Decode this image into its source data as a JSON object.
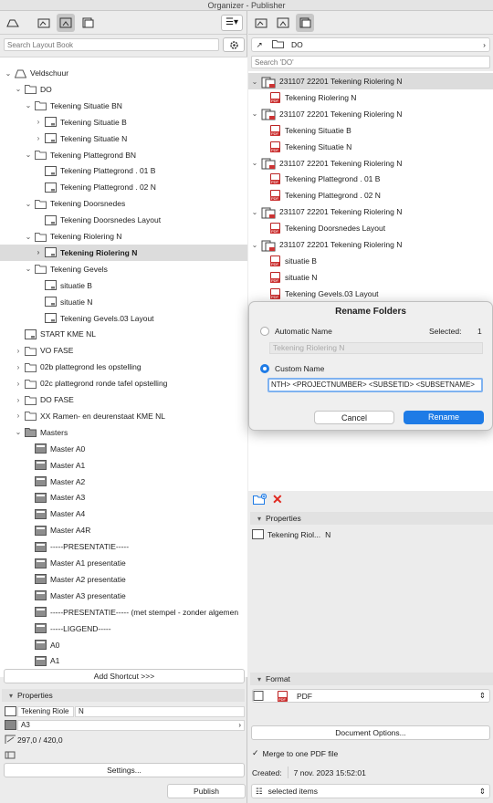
{
  "window": {
    "title": "Organizer - Publisher"
  },
  "left": {
    "search_placeholder": "Search Layout Book",
    "tree": [
      {
        "label": "Veldschuur",
        "depth": 0,
        "chev": "down",
        "icon": "book"
      },
      {
        "label": "DO",
        "depth": 1,
        "chev": "down",
        "icon": "folder"
      },
      {
        "label": "Tekening Situatie BN",
        "depth": 2,
        "chev": "down",
        "icon": "folder"
      },
      {
        "label": "Tekening Situatie B",
        "depth": 3,
        "chev": "right",
        "icon": "layout"
      },
      {
        "label": "Tekening Situatie N",
        "depth": 3,
        "chev": "right",
        "icon": "layout"
      },
      {
        "label": "Tekening Plattegrond BN",
        "depth": 2,
        "chev": "down",
        "icon": "folder"
      },
      {
        "label": "Tekening Plattegrond . 01 B",
        "depth": 3,
        "chev": "",
        "icon": "layout"
      },
      {
        "label": "Tekening Plattegrond . 02 N",
        "depth": 3,
        "chev": "",
        "icon": "layout"
      },
      {
        "label": "Tekening Doorsnedes",
        "depth": 2,
        "chev": "down",
        "icon": "folder"
      },
      {
        "label": "Tekening Doorsnedes Layout",
        "depth": 3,
        "chev": "",
        "icon": "layout"
      },
      {
        "label": "Tekening Riolering N",
        "depth": 2,
        "chev": "down",
        "icon": "folder"
      },
      {
        "label": "Tekening Riolering N",
        "depth": 3,
        "chev": "right",
        "icon": "layout",
        "selected": true
      },
      {
        "label": "Tekening Gevels",
        "depth": 2,
        "chev": "down",
        "icon": "folder"
      },
      {
        "label": "situatie B",
        "depth": 3,
        "chev": "",
        "icon": "layout"
      },
      {
        "label": "situatie N",
        "depth": 3,
        "chev": "",
        "icon": "layout"
      },
      {
        "label": "Tekening Gevels.03 Layout",
        "depth": 3,
        "chev": "",
        "icon": "layout"
      },
      {
        "label": "START KME NL",
        "depth": 1,
        "chev": "",
        "icon": "layout"
      },
      {
        "label": "VO FASE",
        "depth": 1,
        "chev": "right",
        "icon": "folder"
      },
      {
        "label": "02b plattegrond les opstelling",
        "depth": 1,
        "chev": "right",
        "icon": "folder"
      },
      {
        "label": "02c plattegrond ronde tafel opstelling",
        "depth": 1,
        "chev": "right",
        "icon": "folder"
      },
      {
        "label": "DO FASE",
        "depth": 1,
        "chev": "right",
        "icon": "folder"
      },
      {
        "label": "XX Ramen- en deurenstaat KME NL",
        "depth": 1,
        "chev": "right",
        "icon": "folder"
      },
      {
        "label": "Masters",
        "depth": 1,
        "chev": "down",
        "icon": "folder-dark"
      },
      {
        "label": "Master A0",
        "depth": 2,
        "chev": "",
        "icon": "master"
      },
      {
        "label": "Master A1",
        "depth": 2,
        "chev": "",
        "icon": "master"
      },
      {
        "label": "Master A2",
        "depth": 2,
        "chev": "",
        "icon": "master"
      },
      {
        "label": "Master A3",
        "depth": 2,
        "chev": "",
        "icon": "master"
      },
      {
        "label": "Master A4",
        "depth": 2,
        "chev": "",
        "icon": "master"
      },
      {
        "label": "Master A4R",
        "depth": 2,
        "chev": "",
        "icon": "master"
      },
      {
        "label": "-----PRESENTATIE-----",
        "depth": 2,
        "chev": "",
        "icon": "master"
      },
      {
        "label": "Master A1 presentatie",
        "depth": 2,
        "chev": "",
        "icon": "master"
      },
      {
        "label": "Master A2 presentatie",
        "depth": 2,
        "chev": "",
        "icon": "master"
      },
      {
        "label": "Master A3 presentatie",
        "depth": 2,
        "chev": "",
        "icon": "master"
      },
      {
        "label": "-----PRESENTATIE----- (met stempel - zonder algemen",
        "depth": 2,
        "chev": "",
        "icon": "master"
      },
      {
        "label": "-----LIGGEND-----",
        "depth": 2,
        "chev": "",
        "icon": "master"
      },
      {
        "label": "A0",
        "depth": 2,
        "chev": "",
        "icon": "master"
      },
      {
        "label": "A1",
        "depth": 2,
        "chev": "",
        "icon": "master"
      }
    ],
    "add_shortcut": "Add Shortcut >>>",
    "properties_title": "Properties",
    "prop_name": "Tekening Riole",
    "prop_suffix": "N",
    "prop_size": "A3",
    "prop_dims": "297,0 / 420,0",
    "settings_btn": "Settings...",
    "publish_btn": "Publish"
  },
  "right": {
    "path": "DO",
    "search_placeholder": "Search 'DO'",
    "tree": [
      {
        "label": "231107 22201 Tekening Riolering N",
        "depth": 0,
        "kind": "set",
        "selected": true
      },
      {
        "label": "Tekening Riolering N",
        "depth": 1,
        "kind": "pdf"
      },
      {
        "label": "231107 22201 Tekening Riolering N",
        "depth": 0,
        "kind": "set"
      },
      {
        "label": "Tekening Situatie B",
        "depth": 1,
        "kind": "pdf"
      },
      {
        "label": "Tekening Situatie N",
        "depth": 1,
        "kind": "pdf"
      },
      {
        "label": "231107 22201 Tekening Riolering N",
        "depth": 0,
        "kind": "set"
      },
      {
        "label": "Tekening Plattegrond . 01 B",
        "depth": 1,
        "kind": "pdf"
      },
      {
        "label": "Tekening Plattegrond . 02 N",
        "depth": 1,
        "kind": "pdf"
      },
      {
        "label": "231107 22201 Tekening Riolering N",
        "depth": 0,
        "kind": "set"
      },
      {
        "label": "Tekening Doorsnedes Layout",
        "depth": 1,
        "kind": "pdf"
      },
      {
        "label": "231107 22201 Tekening Riolering N",
        "depth": 0,
        "kind": "set"
      },
      {
        "label": "situatie B",
        "depth": 1,
        "kind": "pdf"
      },
      {
        "label": "situatie N",
        "depth": 1,
        "kind": "pdf"
      },
      {
        "label": "Tekening Gevels.03 Layout",
        "depth": 1,
        "kind": "pdf"
      }
    ],
    "properties_title": "Properties",
    "prop_name": "Tekening Riol...",
    "prop_suffix": "N",
    "format_title": "Format",
    "format_value": "PDF",
    "doc_options_btn": "Document Options...",
    "merge_label": "Merge to one PDF file",
    "created_label": "Created:",
    "created_value": "7 nov. 2023 15:52:01",
    "selected_items": "selected items"
  },
  "dialog": {
    "title": "Rename Folders",
    "auto_label": "Automatic Name",
    "selected_label": "Selected:",
    "selected_count": "1",
    "auto_value": "Tekening Riolering N",
    "custom_label": "Custom Name",
    "custom_value": "NTH> <PROJECTNUMBER> <SUBSETID> <SUBSETNAME>",
    "cancel": "Cancel",
    "rename": "Rename"
  },
  "colors": {
    "accent": "#1e7be6",
    "selection": "#dcdcdc",
    "delete": "#e0281f"
  }
}
